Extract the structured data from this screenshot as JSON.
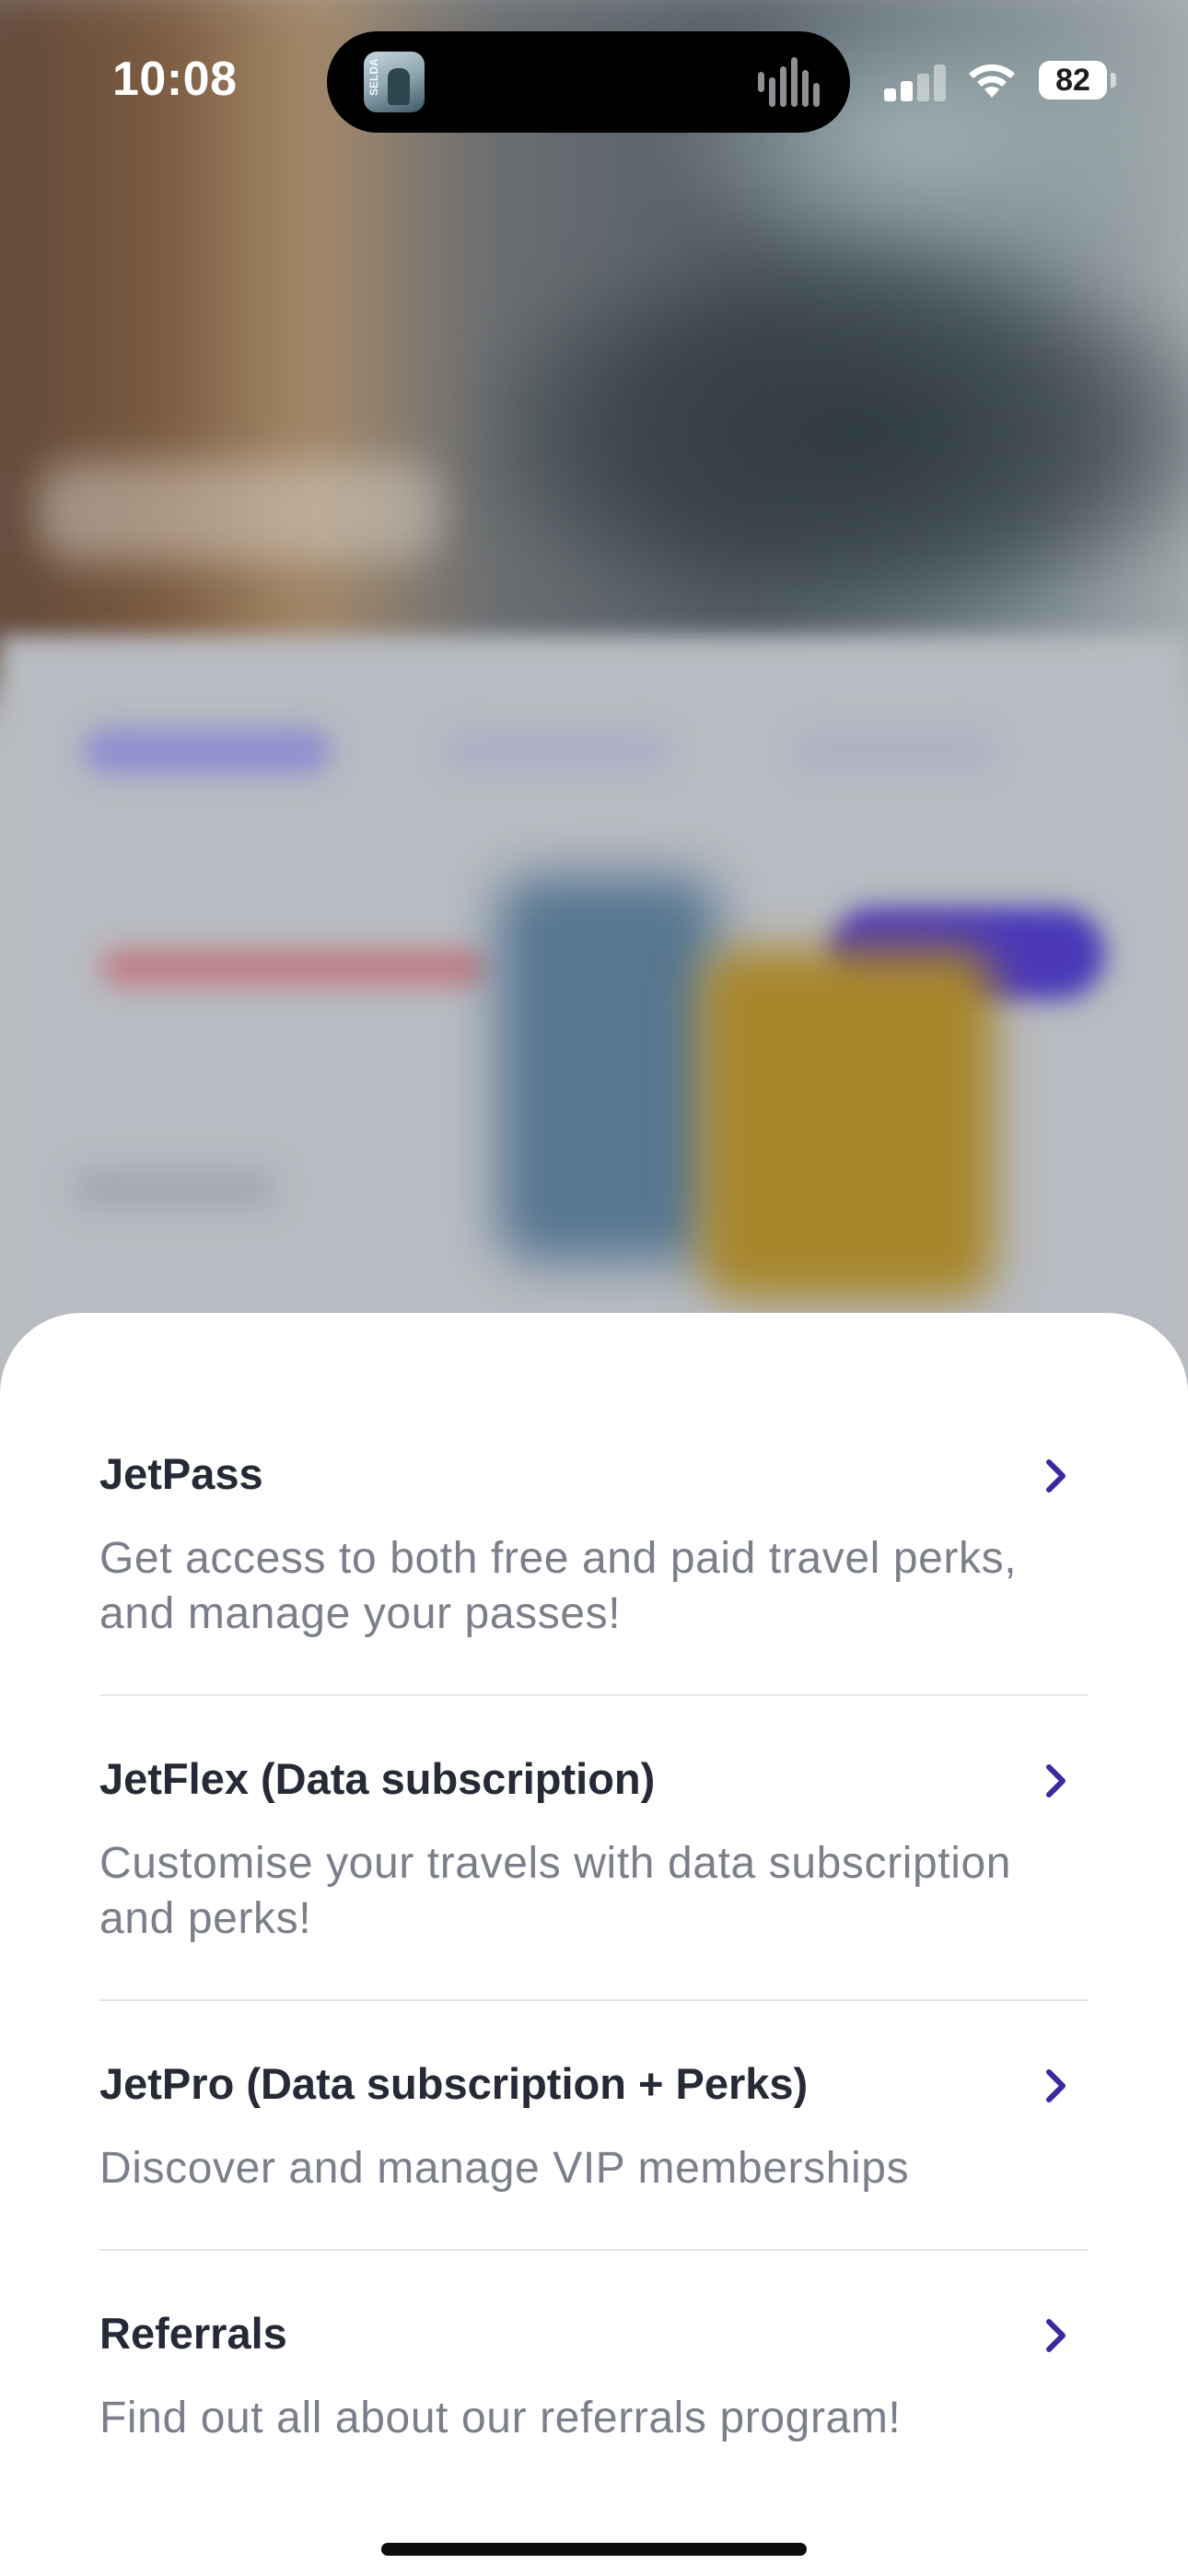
{
  "status_bar": {
    "time": "10:08",
    "battery": "82",
    "island_app_icon_text": "SELDA"
  },
  "colors": {
    "accent": "#3b2a9e",
    "title_text": "#252a36",
    "description_text": "#7a7f8a",
    "divider": "#e4e5e9"
  },
  "menu": {
    "items": [
      {
        "title": "JetPass",
        "description": "Get access to both free and paid travel perks, and manage your passes!",
        "icon": "chevron-right-icon"
      },
      {
        "title": "JetFlex (Data subscription)",
        "description": "Customise your travels with data subscription and perks!",
        "icon": "chevron-right-icon"
      },
      {
        "title": "JetPro (Data subscription + Perks)",
        "description": "Discover and manage VIP memberships",
        "icon": "chevron-right-icon"
      },
      {
        "title": "Referrals",
        "description": "Find out all about our referrals program!",
        "icon": "chevron-right-icon"
      }
    ]
  }
}
